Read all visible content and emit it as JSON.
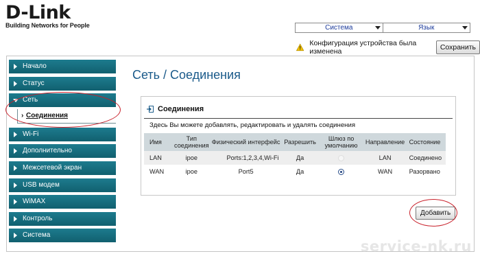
{
  "logo": {
    "brand": "D-Link",
    "tagline": "Building Networks for People"
  },
  "header": {
    "system_menu": "Система",
    "language_menu": "Язык",
    "warning_text": "Конфигурация устройства была изменена",
    "save_label": "Сохранить"
  },
  "sidebar": {
    "items": [
      {
        "label": "Начало"
      },
      {
        "label": "Статус"
      },
      {
        "label": "Сеть",
        "active": true
      },
      {
        "label": "Wi-Fi"
      },
      {
        "label": "Дополнительно"
      },
      {
        "label": "Межсетевой экран"
      },
      {
        "label": "USB модем"
      },
      {
        "label": "WiMAX"
      },
      {
        "label": "Контроль"
      },
      {
        "label": "Система"
      }
    ],
    "subitem": "Соединения"
  },
  "main": {
    "title": "Сеть / Соединения",
    "panel_title": "Соединения",
    "panel_desc": "Здесь Вы можете добавлять, редактировать и удалять соединения",
    "table": {
      "headers": [
        "Имя",
        "Тип соединения",
        "Физический интерфейс",
        "Разрешить",
        "Шлюз по умолчанию",
        "Направление",
        "Состояние"
      ],
      "rows": [
        {
          "name": "LAN",
          "type": "ipoe",
          "iface": "Ports:1,2,3,4,Wi-Fi",
          "enable": "Да",
          "gateway_selected": false,
          "direction": "LAN",
          "state": "Соединено"
        },
        {
          "name": "WAN",
          "type": "ipoe",
          "iface": "Port5",
          "enable": "Да",
          "gateway_selected": true,
          "direction": "WAN",
          "state": "Разорвано"
        }
      ]
    },
    "add_label": "Добавить"
  },
  "watermark": "service-nk.ru",
  "colors": {
    "nav": "#16707f",
    "title": "#1a5a8a",
    "highlight": "#c8202a",
    "table_header": "#cfd8dc"
  }
}
